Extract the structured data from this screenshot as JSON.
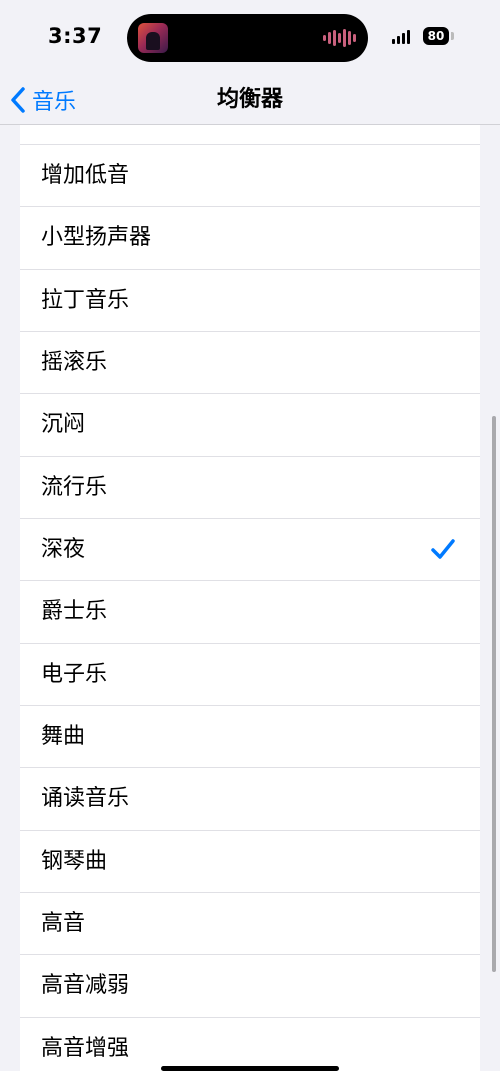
{
  "status_bar": {
    "time": "3:37",
    "battery": "80",
    "now_playing_icon": "album-art-thumbnail",
    "waveform_color": "#c9607d"
  },
  "nav": {
    "back_label": "音乐",
    "title": "均衡器",
    "accent": "#007aff"
  },
  "equalizer_presets": {
    "items": [
      {
        "label": "增加低音",
        "selected": false
      },
      {
        "label": "小型扬声器",
        "selected": false
      },
      {
        "label": "拉丁音乐",
        "selected": false
      },
      {
        "label": "摇滚乐",
        "selected": false
      },
      {
        "label": "沉闷",
        "selected": false
      },
      {
        "label": "流行乐",
        "selected": false
      },
      {
        "label": "深夜",
        "selected": true
      },
      {
        "label": "爵士乐",
        "selected": false
      },
      {
        "label": "电子乐",
        "selected": false
      },
      {
        "label": "舞曲",
        "selected": false
      },
      {
        "label": "诵读音乐",
        "selected": false
      },
      {
        "label": "钢琴曲",
        "selected": false
      },
      {
        "label": "高音",
        "selected": false
      },
      {
        "label": "高音减弱",
        "selected": false
      },
      {
        "label": "高音增强",
        "selected": false
      }
    ]
  }
}
